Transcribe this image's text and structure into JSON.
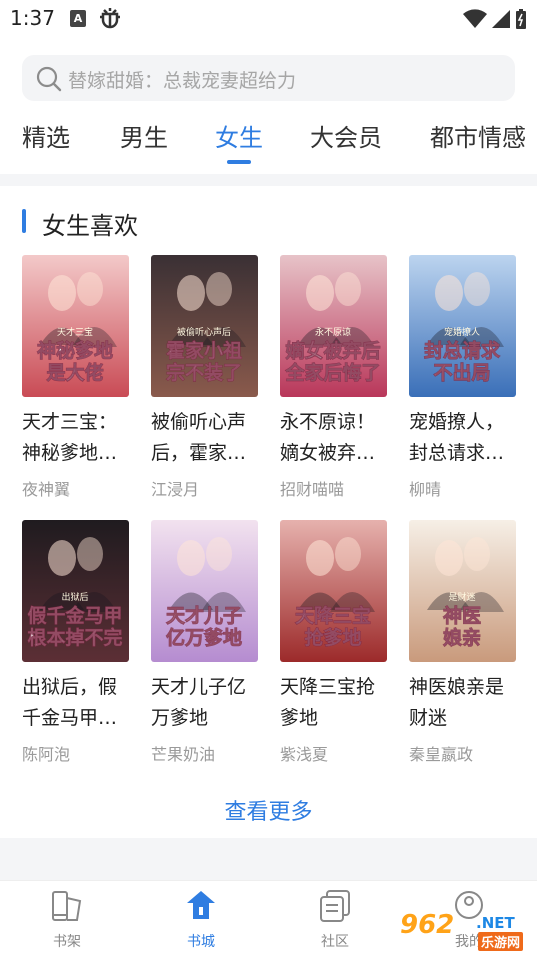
{
  "status": {
    "time": "1:37",
    "badge": "A"
  },
  "search": {
    "placeholder": "替嫁甜婚：总裁宠妻超给力"
  },
  "tabs": [
    {
      "label": "精选"
    },
    {
      "label": "男生"
    },
    {
      "label": "女生"
    },
    {
      "label": "大会员"
    },
    {
      "label": "都市情感"
    }
  ],
  "section": {
    "title": "女生喜欢"
  },
  "books": [
    {
      "title": "天才三宝：神秘爹地是大佬",
      "author": "夜神翼",
      "cover_text": "神秘爹地是大佬",
      "cover_sub": "天才三宝",
      "bg": [
        "#f3c9c9",
        "#c94b55"
      ]
    },
    {
      "title": "被偷听心声后，霍家小祖宗不装了",
      "author": "江浸月",
      "cover_text": "霍家小祖宗不装了",
      "cover_sub": "被偷听心声后",
      "bg": [
        "#3a3034",
        "#8a5a4c"
      ]
    },
    {
      "title": "永不原谅！嫡女被弃后全家后悔了",
      "author": "招财喵喵",
      "cover_text": "嫡女被弃后全家后悔了",
      "cover_sub": "永不原谅",
      "bg": [
        "#e7c3c8",
        "#b9375a"
      ]
    },
    {
      "title": "宠婚撩人，封总请求不出局",
      "author": "柳晴",
      "cover_text": "封总请求不出局",
      "cover_sub": "宠婚撩人",
      "bg": [
        "#bcd4ef",
        "#3a6fb8"
      ]
    },
    {
      "title": "出狱后，假千金马甲根本掉不完",
      "author": "陈阿泡",
      "cover_text": "假千金马甲根本掉不完",
      "cover_sub": "出狱后",
      "bg": [
        "#1f1b1f",
        "#5c2f35"
      ]
    },
    {
      "title": "天才儿子亿万爹地",
      "author": "芒果奶油",
      "cover_text": "天才儿子亿万爹地",
      "cover_sub": "",
      "bg": [
        "#f2e2ef",
        "#b58cd0"
      ]
    },
    {
      "title": "天降三宝抢爹地",
      "author": "紫浅夏",
      "cover_text": "天降三宝抢爹地",
      "cover_sub": "",
      "bg": [
        "#e6b1ad",
        "#9c2a2a"
      ]
    },
    {
      "title": "神医娘亲是财迷",
      "author": "秦皇嬴政",
      "cover_text": "神医娘亲",
      "cover_sub": "是财迷",
      "bg": [
        "#f6efe6",
        "#c99a7c"
      ]
    }
  ],
  "more_label": "查看更多",
  "bottom_nav": [
    {
      "label": "书架",
      "icon": "bookshelf-icon"
    },
    {
      "label": "书城",
      "icon": "bookstore-icon"
    },
    {
      "label": "社区",
      "icon": "community-icon"
    },
    {
      "label": "我的",
      "icon": "profile-icon"
    }
  ],
  "watermark": {
    "num": "962",
    "net": ".NET",
    "cn": "乐游网"
  },
  "colors": {
    "accent": "#2f7de1",
    "muted": "#9a9a9a",
    "band": "#f4f5f7"
  }
}
